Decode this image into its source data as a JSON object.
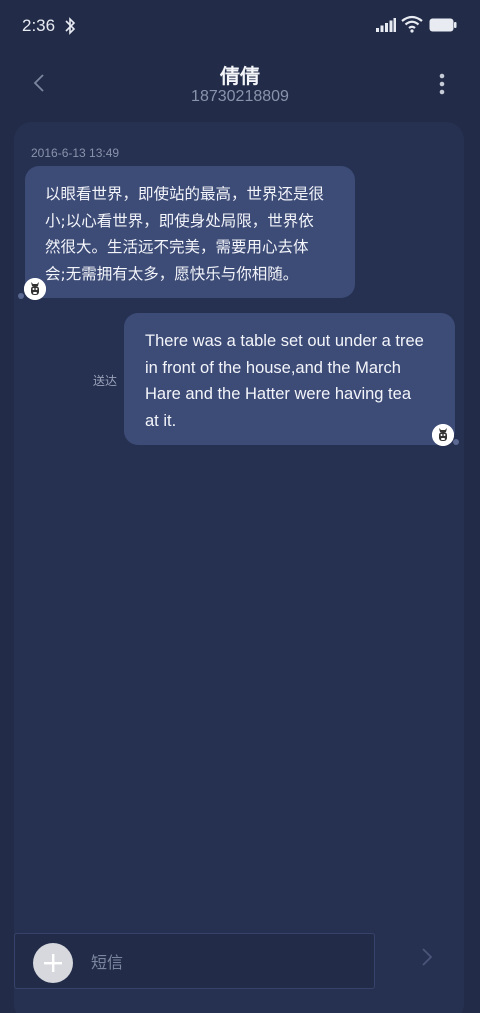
{
  "status_bar": {
    "time": "2:36",
    "icons": [
      "bluetooth-icon",
      "signal-icon",
      "wifi-icon",
      "battery-icon"
    ]
  },
  "header": {
    "contact_name": "倩倩",
    "contact_number": "18730218809",
    "back_icon": "chevron-left-icon",
    "more_icon": "more-vertical-icon"
  },
  "conversation": {
    "timestamp": "2016-6-13 13:49",
    "messages": [
      {
        "direction": "incoming",
        "lines": [
          "以眼看世界，即使站的最高，世界还是很",
          "小;以心看世界，即使身处局限，世界依",
          "然很大。生活远不完美，需要用心去体",
          "会;无需拥有太多，愿快乐与你相随。"
        ]
      },
      {
        "direction": "outgoing",
        "lines": [
          "There was a table set out under a tree",
          "in front of the house,and the March",
          "Hare and the Hatter were having tea",
          "at it."
        ],
        "status": "送达"
      }
    ]
  },
  "compose": {
    "placeholder": "短信",
    "value": "",
    "add_icon": "plus-icon",
    "send_icon": "chevron-right-icon"
  },
  "colors": {
    "background": "#222c48",
    "panel": "#263152",
    "bubble": "#3d4b77",
    "muted_text": "#8a93ab"
  }
}
